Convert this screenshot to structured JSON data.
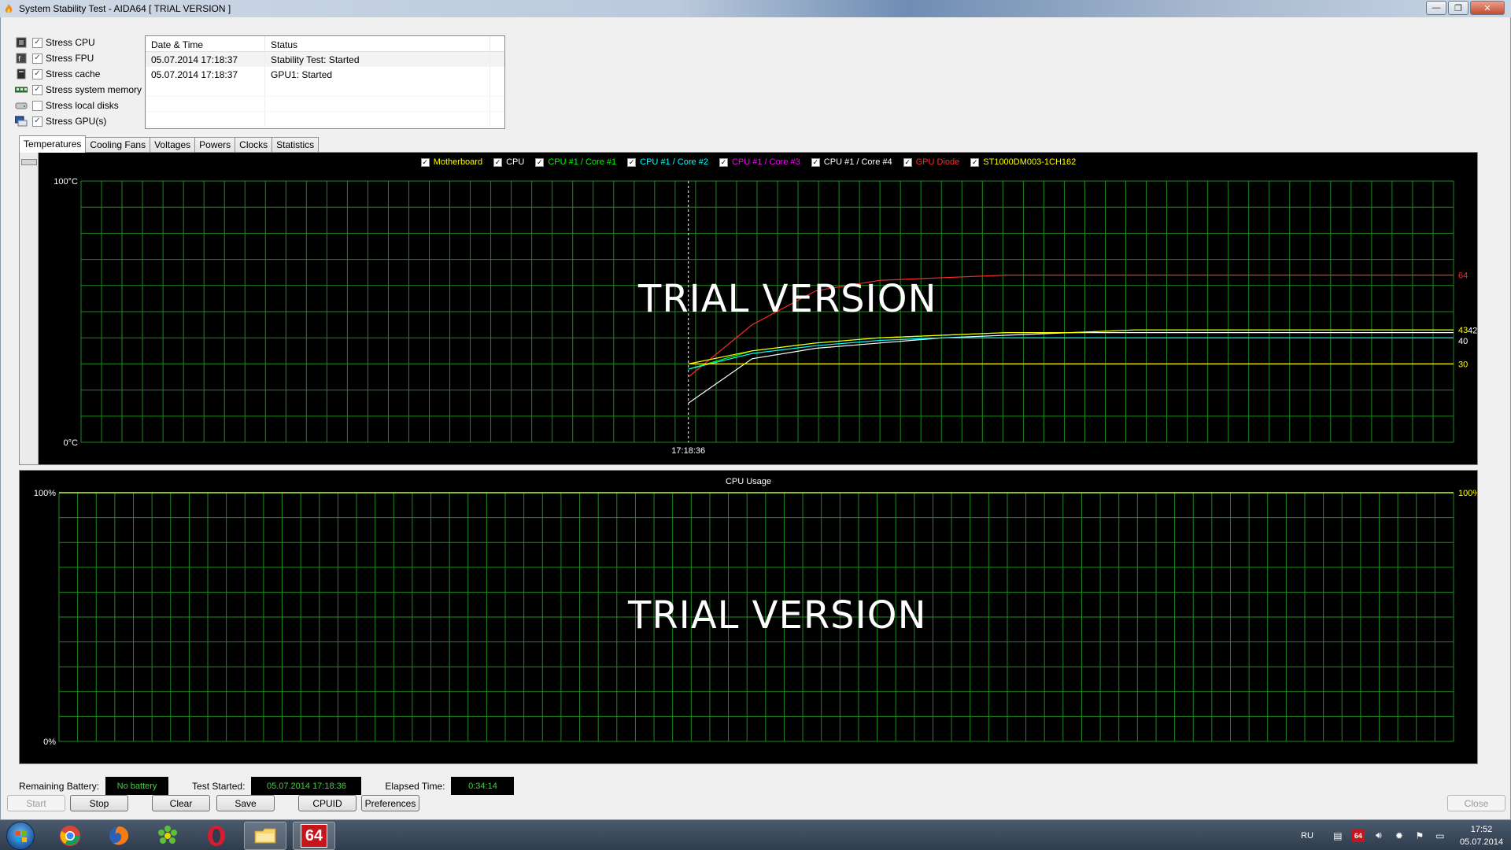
{
  "window": {
    "title": "System Stability Test - AIDA64  [ TRIAL VERSION ]",
    "controls": [
      "—",
      "❐",
      "✕"
    ]
  },
  "stress_options": [
    {
      "label": "Stress CPU",
      "checked": true,
      "icon": "cpu-icon"
    },
    {
      "label": "Stress FPU",
      "checked": true,
      "icon": "fpu-icon"
    },
    {
      "label": "Stress cache",
      "checked": true,
      "icon": "cache-icon"
    },
    {
      "label": "Stress system memory",
      "checked": true,
      "icon": "memory-icon"
    },
    {
      "label": "Stress local disks",
      "checked": false,
      "icon": "disk-icon"
    },
    {
      "label": "Stress GPU(s)",
      "checked": true,
      "icon": "gpu-icon"
    }
  ],
  "log": {
    "headers": [
      "Date & Time",
      "Status"
    ],
    "rows": [
      {
        "datetime": "05.07.2014 17:18:37",
        "status": "Stability Test: Started"
      },
      {
        "datetime": "05.07.2014 17:18:37",
        "status": "GPU1: Started"
      }
    ]
  },
  "tabs": [
    "Temperatures",
    "Cooling Fans",
    "Voltages",
    "Powers",
    "Clocks",
    "Statistics"
  ],
  "active_tab": "Temperatures",
  "temperature_legend": [
    {
      "label": "Motherboard",
      "color": "#ffff00"
    },
    {
      "label": "CPU",
      "color": "#ffffff"
    },
    {
      "label": "CPU #1 / Core #1",
      "color": "#00ff00"
    },
    {
      "label": "CPU #1 / Core #2",
      "color": "#00ffff"
    },
    {
      "label": "CPU #1 / Core #3",
      "color": "#ff00ff"
    },
    {
      "label": "CPU #1 / Core #4",
      "color": "#ffffff"
    },
    {
      "label": "GPU Diode",
      "color": "#ff2a2a"
    },
    {
      "label": "ST1000DM003-1CH162",
      "color": "#ffff00"
    }
  ],
  "temp_graph": {
    "y_max_label": "100°C",
    "y_min_label": "0°C",
    "marker_time": "17:18:36",
    "watermark": "TRIAL VERSION",
    "end_labels": [
      "64",
      "43",
      "42",
      "40",
      "30"
    ]
  },
  "cpu_graph": {
    "title": "CPU Usage",
    "y_max_label": "100%",
    "y_min_label": "0%",
    "right_label": "100%",
    "watermark": "TRIAL VERSION"
  },
  "chart_data": [
    {
      "type": "line",
      "title": "",
      "ylabel": "°C",
      "ylim": [
        0,
        100
      ],
      "series": [
        {
          "name": "GPU Diode",
          "color": "#ff2a2a",
          "values": [
            25,
            45,
            58,
            62,
            63,
            64,
            64,
            64,
            64,
            64,
            64,
            64,
            64
          ]
        },
        {
          "name": "CPU",
          "color": "#ffffff",
          "values": [
            15,
            32,
            36,
            38,
            40,
            41,
            42,
            42,
            42,
            42,
            42,
            42,
            42
          ]
        },
        {
          "name": "CPU #1 / Core #1",
          "color": "#00ff00",
          "values": [
            28,
            35,
            38,
            40,
            41,
            42,
            42,
            43,
            43,
            43,
            43,
            43,
            43
          ]
        },
        {
          "name": "CPU #1 / Core #2",
          "color": "#00ffff",
          "values": [
            28,
            34,
            37,
            39,
            40,
            40,
            40,
            40,
            40,
            40,
            40,
            40,
            40
          ]
        },
        {
          "name": "Motherboard",
          "color": "#ffff00",
          "values": [
            30,
            30,
            30,
            30,
            30,
            30,
            30,
            30,
            30,
            30,
            30,
            30,
            30
          ]
        },
        {
          "name": "ST1000DM003-1CH162",
          "color": "#ffff00",
          "values": [
            30,
            35,
            38,
            40,
            41,
            42,
            42,
            43,
            43,
            43,
            43,
            43,
            43
          ]
        }
      ]
    },
    {
      "type": "line",
      "title": "CPU Usage",
      "ylim": [
        0,
        100
      ],
      "series": [
        {
          "name": "",
          "color": "#b7ff2b",
          "values": [
            100,
            100,
            100,
            100,
            100,
            100,
            100,
            100,
            100,
            100,
            100,
            100,
            100
          ]
        }
      ]
    }
  ],
  "status": {
    "battery_label": "Remaining Battery:",
    "battery_value": "No battery",
    "started_label": "Test Started:",
    "started_value": "05.07.2014 17:18:36",
    "elapsed_label": "Elapsed Time:",
    "elapsed_value": "0:34:14"
  },
  "buttons": {
    "start": "Start",
    "stop": "Stop",
    "clear": "Clear",
    "save": "Save",
    "cpuid": "CPUID",
    "preferences": "Preferences",
    "close": "Close"
  },
  "taskbar": {
    "apps": [
      "chrome-icon",
      "firefox-icon",
      "icq-icon",
      "opera-icon",
      "explorer-icon",
      "aida64-icon"
    ],
    "aida_label": "64",
    "language": "RU",
    "tray_badge": "64",
    "time": "17:52",
    "date": "05.07.2014"
  }
}
